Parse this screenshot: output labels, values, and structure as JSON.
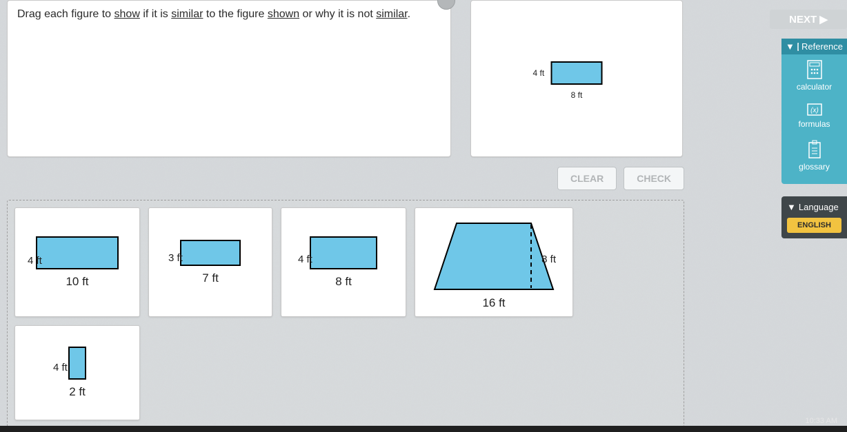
{
  "instruction": {
    "pre": "Drag each figure to ",
    "u1": "show",
    "mid1": " if it is ",
    "u2": "similar",
    "mid2": " to the figure ",
    "u3": "shown",
    "mid3": " or why it is not ",
    "u4": "similar",
    "end": "."
  },
  "reference_shape": {
    "left": "4 ft",
    "bottom": "8 ft"
  },
  "actions": {
    "clear": "CLEAR",
    "check": "CHECK"
  },
  "cards": [
    {
      "left": "4 ft",
      "bottom": "10 ft"
    },
    {
      "left": "3 ft",
      "bottom": "7 ft"
    },
    {
      "left": "4 ft",
      "bottom": "8 ft"
    },
    {
      "right": "8 ft",
      "bottom": "16 ft"
    },
    {
      "left": "4 ft",
      "bottom": "2 ft"
    }
  ],
  "sidebar": {
    "next": "NEXT ▶",
    "ref_header": "Reference",
    "calculator": "calculator",
    "formulas": "formulas",
    "glossary": "glossary",
    "lang_header": "Language",
    "lang_chip": "ENGLISH"
  },
  "time": "10:33 AM"
}
